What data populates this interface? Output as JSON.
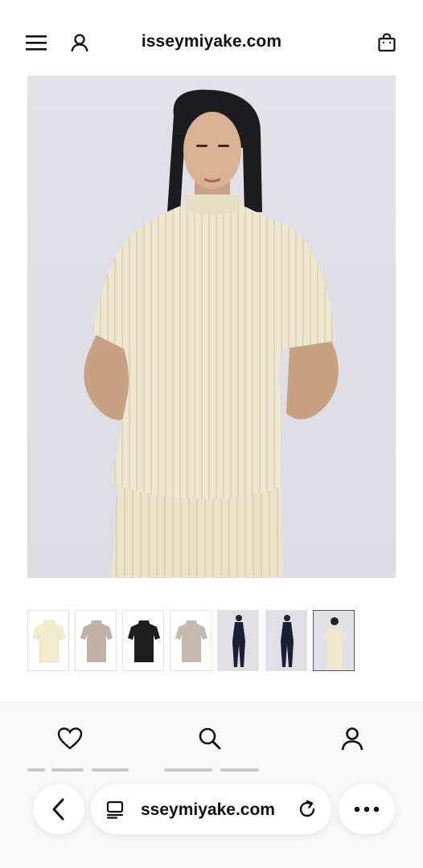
{
  "header": {
    "site_title": "isseymiyake.com",
    "menu_icon": "hamburger-menu-icon",
    "account_icon": "user-icon",
    "bag_icon": "shopping-bag-icon"
  },
  "product": {
    "main_image": "model wearing cream ribbed short-sleeve top",
    "thumbnails": [
      {
        "kind": "product",
        "color": "#f3edcf"
      },
      {
        "kind": "product",
        "color": "#bfb3ab"
      },
      {
        "kind": "product",
        "color": "#1e1e1e"
      },
      {
        "kind": "product",
        "color": "#c5bab2"
      },
      {
        "kind": "model",
        "color": "#1a1f33"
      },
      {
        "kind": "model",
        "color": "#1a1f33"
      },
      {
        "kind": "model",
        "color": "#efe7cf",
        "selected": true
      }
    ]
  },
  "tabbar": {
    "wishlist_icon": "heart-icon",
    "search_icon": "search-icon",
    "account_icon": "user-icon"
  },
  "browser": {
    "back_icon": "chevron-left-icon",
    "tabs_icon": "tabs-icon",
    "url": "sseymiyake.com",
    "reload_icon": "reload-icon",
    "more_icon": "more-icon"
  }
}
